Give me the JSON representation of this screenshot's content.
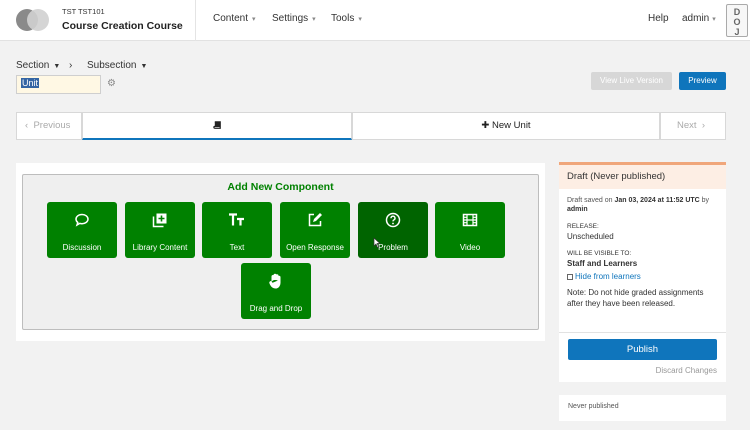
{
  "header": {
    "course_org": "TST TST101",
    "course_title": "Course Creation Course",
    "nav": [
      {
        "label": "Content"
      },
      {
        "label": "Settings"
      },
      {
        "label": "Tools"
      }
    ],
    "help": "Help",
    "user": "admin",
    "badge": [
      "D",
      "O",
      "J",
      "T"
    ]
  },
  "breadcrumb": {
    "section": "Section",
    "subsection": "Subsection",
    "separator": "›"
  },
  "unit": {
    "name_value": "Unit"
  },
  "actions": {
    "view_live": "View Live Version",
    "preview": "Preview"
  },
  "sequence": {
    "previous": "Previous",
    "new_unit": "New Unit",
    "next": "Next"
  },
  "add_component": {
    "title": "Add New Component",
    "items": [
      {
        "label": "Discussion",
        "icon": "discussion-icon"
      },
      {
        "label": "Library Content",
        "icon": "library-icon"
      },
      {
        "label": "Text",
        "icon": "text-icon"
      },
      {
        "label": "Open Response",
        "icon": "open-response-icon"
      },
      {
        "label": "Problem",
        "icon": "problem-icon"
      },
      {
        "label": "Video",
        "icon": "video-icon"
      },
      {
        "label": "Drag and Drop",
        "icon": "hand-icon"
      }
    ]
  },
  "status": {
    "heading": "Draft (Never published)",
    "draft_saved_prefix": "Draft saved on",
    "draft_saved_date": "Jan 03, 2024 at 11:52 UTC",
    "draft_saved_by": "by",
    "draft_saved_user": "admin",
    "release_label": "RELEASE:",
    "release_value": "Unscheduled",
    "visible_label": "WILL BE VISIBLE TO:",
    "visible_value": "Staff and Learners",
    "hide_link": "Hide from learners",
    "note": "Note: Do not hide graded assignments after they have been released.",
    "publish": "Publish",
    "discard": "Discard Changes",
    "never_published": "Never published"
  },
  "colors": {
    "green": "#008100",
    "blue": "#0f75bc",
    "draft_accent": "#f0a67a"
  }
}
